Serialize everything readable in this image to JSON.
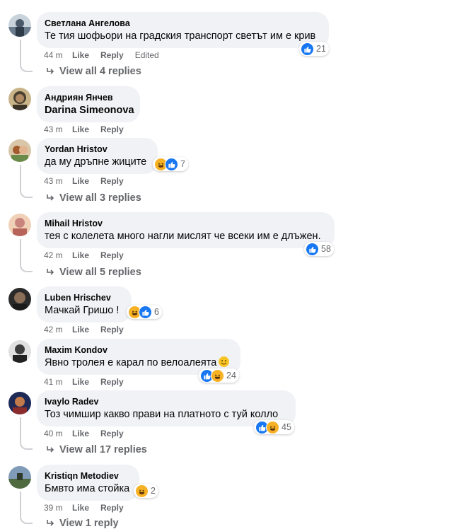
{
  "comments": [
    {
      "author": "Светлана Ангелова",
      "text": "Те тия шофьори на градския транспорт светът им е крив",
      "time": "44 m",
      "like": "Like",
      "reply": "Reply",
      "edited": "Edited",
      "reactions": [
        "like"
      ],
      "reaction_count": "21",
      "replies": "View all 4 replies",
      "avatar_colors": [
        "#6b7c8e",
        "#c8d3dc"
      ]
    },
    {
      "author": "Андриян Янчев",
      "text": "Darina Simeonova",
      "tag": true,
      "time": "43 m",
      "like": "Like",
      "reply": "Reply",
      "avatar_colors": [
        "#4a4030",
        "#c9b48a"
      ]
    },
    {
      "author": "Yordan Hristov",
      "text": "да му дръпне жиците",
      "time": "43 m",
      "like": "Like",
      "reply": "Reply",
      "reactions": [
        "haha",
        "like"
      ],
      "reaction_count": "7",
      "replies": "View all 3 replies",
      "avatar_colors": [
        "#a35a2c",
        "#e2b48e"
      ]
    },
    {
      "author": "Mihail Hristov",
      "text": "тея с колелета много нагли мислят че всеки им е длъжен.",
      "time": "42 m",
      "like": "Like",
      "reply": "Reply",
      "reactions": [
        "like"
      ],
      "reaction_count": "58",
      "replies": "View all 5 replies",
      "avatar_colors": [
        "#c9857d",
        "#f0d1b8"
      ]
    },
    {
      "author": "Luben Hrischev",
      "text": "Мачкай Гришо !",
      "time": "42 m",
      "like": "Like",
      "reply": "Reply",
      "reactions": [
        "haha",
        "like"
      ],
      "reaction_count": "6",
      "avatar_colors": [
        "#2a2a2a",
        "#8a6e58"
      ]
    },
    {
      "author": "Maxim Kondov",
      "text": "Явно тролея е карал по велоалеята",
      "emoji": "slightly-smiling-face-icon",
      "time": "41 m",
      "like": "Like",
      "reply": "Reply",
      "reactions": [
        "like",
        "haha"
      ],
      "reaction_count": "24",
      "avatar_colors": [
        "#3d3d3d",
        "#e0e0e0"
      ]
    },
    {
      "author": "Ivaylo Radev",
      "text": "Тоз чимшир какво прави на платното с туй колло",
      "time": "40 m",
      "like": "Like",
      "reply": "Reply",
      "reactions": [
        "like",
        "haha"
      ],
      "reaction_count": "45",
      "replies": "View all 17 replies",
      "avatar_colors": [
        "#1e2a55",
        "#c27a4a"
      ]
    },
    {
      "author": "Kristiqn Metodiev",
      "text": "Бмвто има стойка",
      "time": "39 m",
      "like": "Like",
      "reply": "Reply",
      "reactions": [
        "haha"
      ],
      "reaction_count": "2",
      "replies": "View 1 reply",
      "avatar_colors": [
        "#7f9bb8",
        "#4f6a3f"
      ]
    }
  ],
  "colors": {
    "like": "#1877f2",
    "haha": "#f7b125",
    "bubble": "#f0f2f5",
    "meta": "#65676b"
  }
}
